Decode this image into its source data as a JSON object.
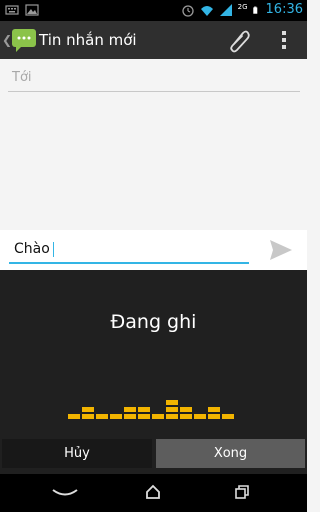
{
  "status_bar": {
    "time": "16:36",
    "network": "2G"
  },
  "action_bar": {
    "title": "Tin nhắn mới"
  },
  "recipient": {
    "placeholder": "Tới"
  },
  "compose": {
    "text": "Chào"
  },
  "voice": {
    "status": "Đang ghi",
    "cancel_label": "Hủy",
    "done_label": "Xong"
  },
  "colors": {
    "accent": "#33b5e5",
    "level_meter": "#f2b400"
  }
}
